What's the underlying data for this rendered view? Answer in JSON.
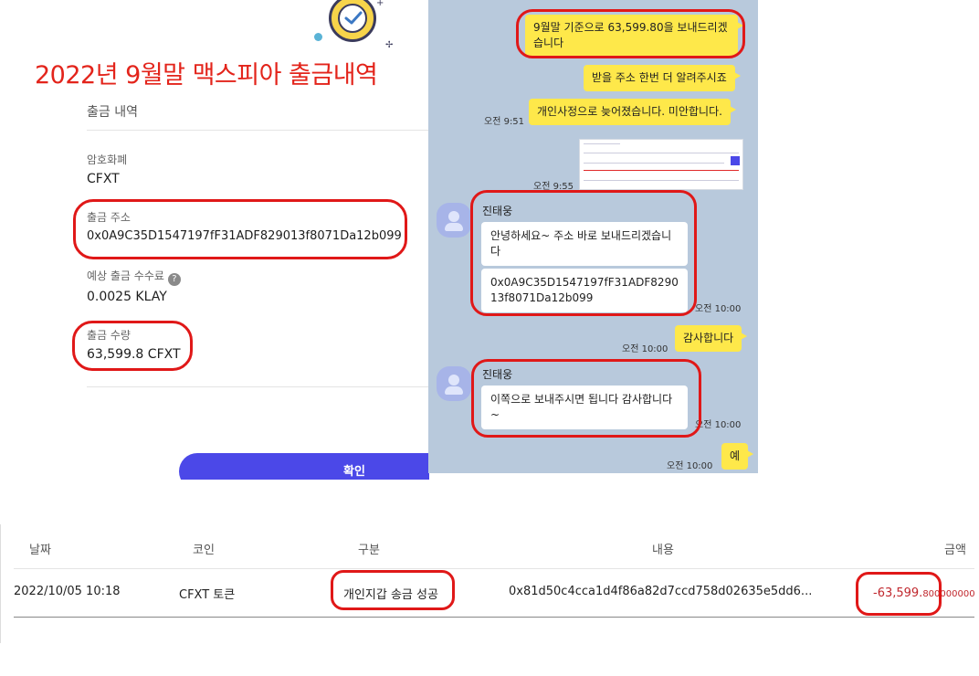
{
  "withdrawal_panel": {
    "heading_annotation": "2022년 9월말 맥스피아 출금내역",
    "section_title": "출금 내역",
    "currency_label": "암호화폐",
    "currency_value": "CFXT",
    "address_label": "출금 주소",
    "address_value": "0x0A9C35D1547197fF31ADF829013f8071Da12b099",
    "fee_label": "예상 출금 수수료",
    "fee_help": "?",
    "fee_value": "0.0025 KLAY",
    "amount_label": "출금 수량",
    "amount_value": "63,599.8 CFXT",
    "confirm_label": "확인",
    "colors": {
      "annotation": "#e3241b",
      "button": "#4b48e8"
    }
  },
  "chat": {
    "messages": {
      "m1": "9월말 기준으로 63,599.80을 보내드리겠습니다",
      "m2": "받을 주소 한번 더 알려주시죠",
      "m3": "개인사정으로 늦어졌습니다. 미안합니다.",
      "m3_time": "오전 9:51",
      "m4_time": "오전 9:55",
      "reply1_name": "진태웅",
      "reply1_text": "안녕하세요~ 주소 바로 보내드리겠습니다",
      "reply1_addr": "0x0A9C35D1547197fF31ADF829013f8071Da12b099",
      "reply1_time": "오전 10:00",
      "m5": "감사합니다",
      "m5_time": "오전 10:00",
      "reply2_name": "진태웅",
      "reply2_text": "이쪽으로 보내주시면 됩니다 감사합니다~",
      "reply2_time": "오전 10:00",
      "m6": "예",
      "m6_time": "오전 10:00"
    },
    "colors": {
      "background": "#b8c9dc",
      "my_bubble": "#fee84a",
      "their_bubble": "#ffffff"
    }
  },
  "history_table": {
    "headers": {
      "date": "날짜",
      "coin": "코인",
      "type": "구분",
      "content": "내용",
      "amount": "금액"
    },
    "row": {
      "date": "2022/10/05 10:18",
      "coin": "CFXT 토큰",
      "type": "개인지갑 송금 성공",
      "content": "0x81d50c4cca1d4f86a82d7ccd758d02635e5dd6...",
      "amount_main": "-63,599.",
      "amount_decimals": "800000000"
    },
    "colors": {
      "amount": "#c0272d",
      "annotation_oval": "#e01818"
    }
  }
}
